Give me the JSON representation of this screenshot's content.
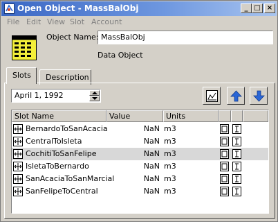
{
  "window": {
    "title": "Open Object - MassBalObj"
  },
  "titlebar_buttons": {
    "minimize": "_",
    "maximize": "□",
    "close": "×"
  },
  "menu": [
    "File",
    "Edit",
    "View",
    "Slot",
    "Account"
  ],
  "object": {
    "name_label": "Object Name:",
    "name_value": "MassBalObj",
    "type": "Data Object"
  },
  "tabs": [
    {
      "label": "Slots",
      "active": true
    },
    {
      "label": "Description",
      "active": false
    }
  ],
  "date": {
    "value": "April 1, 1992"
  },
  "toolbar": {
    "plot_icon": "plot-icon",
    "up_icon": "arrow-up-icon",
    "down_icon": "arrow-down-icon"
  },
  "table": {
    "columns": [
      "Slot Name",
      "Value",
      "Units"
    ],
    "rows": [
      {
        "name": "BernardoToSanAcacia",
        "value": "NaN",
        "units": "m3",
        "selected": false
      },
      {
        "name": "CentralToIsleta",
        "value": "NaN",
        "units": "m3",
        "selected": false
      },
      {
        "name": "CochitiToSanFelipe",
        "value": "NaN",
        "units": "m3",
        "selected": true
      },
      {
        "name": "IsletaToBernardo",
        "value": "NaN",
        "units": "m3",
        "selected": false
      },
      {
        "name": "SanAcaciaToSanMarcial",
        "value": "NaN",
        "units": "m3",
        "selected": false
      },
      {
        "name": "SanFelipeToCentral",
        "value": "NaN",
        "units": "m3",
        "selected": false
      }
    ]
  },
  "colors": {
    "title_start": "#3a67c4",
    "title_end": "#a9c5ef",
    "selected_row": "#d8d8d8",
    "arrow_blue": "#2a66d6"
  }
}
